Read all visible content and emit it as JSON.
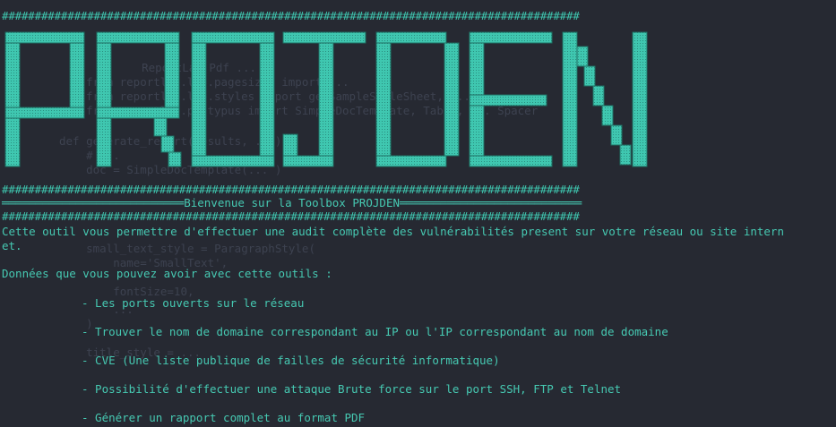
{
  "terminal": {
    "hash_line": "########################################################################################",
    "banner_text": "PROJDEN",
    "welcome_line": "═══════════════════════════Bienvenue sur la Toolbox PROJDEN═══════════════════════════",
    "intro_line1": "Cette outil vous permettre d'effectuer une audit complète des vulnérabilités present sur votre réseau ou site intern",
    "intro_line2": "et.",
    "data_heading": "Données que vous pouvez avoir avec cette outils :",
    "items": [
      "- Les ports ouverts sur le réseau",
      "- Trouver le nom de domaine correspondant au IP ou l'IP correspondant au nom de domaine",
      "- CVE (Une liste publique de failles de sécurité informatique)",
      "- Possibilité d'effectuer une attaque Brute force sur le port SSH, FTP et Telnet",
      "- Générer un rapport complet au format PDF"
    ]
  },
  "background_code": {
    "lines": [
      "    ReportLab Pdf ... ",
      "from reportlab.lib.pagesizes import ...",
      "from reportlab.lib.styles import getSampleStyleSheet, ...",
      "from reportlab.platypus import SimpleDocTemplate, Table, ... Spacer",
      "def generate_report(results, ...):",
      "    # ...",
      "    doc = SimpleDocTemplate(... )",
      "    small_text_style = ParagraphStyle(",
      "        name='SmallText',",
      "        fontSize=10,",
      "        ...",
      "    )",
      "    title_style = ..."
    ]
  },
  "colors": {
    "background": "#262932",
    "accent": "#46c9b2",
    "banner_fill": "#3fc7b0",
    "banner_shadow": "#1f6f63"
  }
}
